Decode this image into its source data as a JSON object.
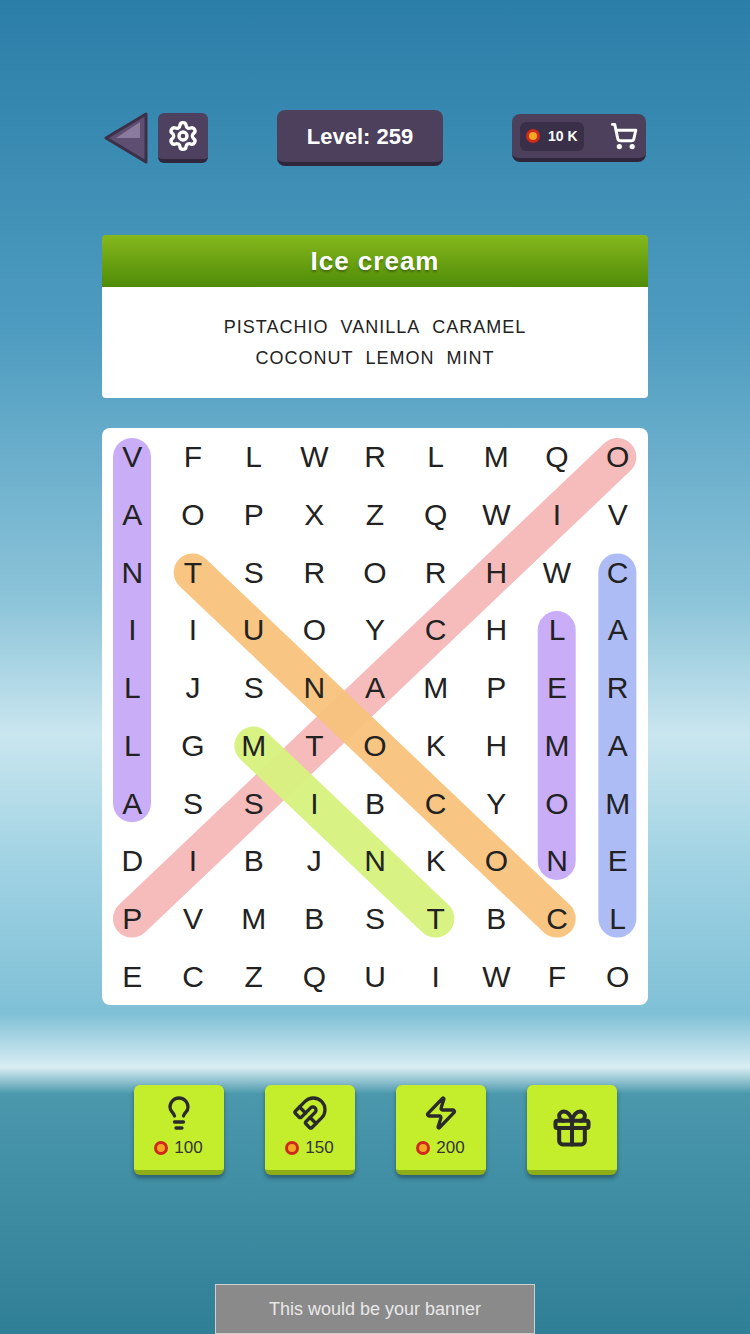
{
  "top_bar": {
    "level": "Level: 259",
    "coins": "10 K"
  },
  "category": {
    "title": "Ice cream",
    "words": [
      "PISTACHIO",
      "VANILLA",
      "CARAMEL",
      "COCONUT",
      "LEMON",
      "MINT"
    ]
  },
  "grid": {
    "rows": [
      [
        "V",
        "F",
        "L",
        "W",
        "R",
        "L",
        "M",
        "Q",
        "O"
      ],
      [
        "A",
        "O",
        "P",
        "X",
        "Z",
        "Q",
        "W",
        "I",
        "V"
      ],
      [
        "N",
        "T",
        "S",
        "R",
        "O",
        "R",
        "H",
        "W",
        "C"
      ],
      [
        "I",
        "I",
        "U",
        "O",
        "Y",
        "C",
        "H",
        "L",
        "A"
      ],
      [
        "L",
        "J",
        "S",
        "N",
        "A",
        "M",
        "P",
        "E",
        "R"
      ],
      [
        "L",
        "G",
        "M",
        "T",
        "O",
        "K",
        "H",
        "M",
        "A"
      ],
      [
        "A",
        "S",
        "S",
        "I",
        "B",
        "C",
        "Y",
        "O",
        "M"
      ],
      [
        "D",
        "I",
        "B",
        "J",
        "N",
        "K",
        "O",
        "N",
        "E"
      ],
      [
        "P",
        "V",
        "M",
        "B",
        "S",
        "T",
        "B",
        "C",
        "L"
      ],
      [
        "E",
        "C",
        "Z",
        "Q",
        "U",
        "I",
        "W",
        "F",
        "O"
      ]
    ]
  },
  "found": [
    {
      "word": "VANILLA",
      "color": "#c8a9f7",
      "from": [
        0,
        0
      ],
      "to": [
        6,
        0
      ]
    },
    {
      "word": "PISTACHIO",
      "color": "#f6b8b8",
      "from": [
        8,
        0
      ],
      "to": [
        0,
        8
      ]
    },
    {
      "word": "COCONUT",
      "color": "#f8c27c",
      "from": [
        8,
        7
      ],
      "to": [
        2,
        1
      ]
    },
    {
      "word": "MINT",
      "color": "#d8f27e",
      "from": [
        5,
        2
      ],
      "to": [
        8,
        5
      ]
    },
    {
      "word": "LEMON",
      "color": "#c8a9f7",
      "from": [
        3,
        7
      ],
      "to": [
        7,
        7
      ]
    },
    {
      "word": "CARAMEL",
      "color": "#aab9f6",
      "from": [
        2,
        8
      ],
      "to": [
        8,
        8
      ]
    }
  ],
  "boosters": [
    {
      "kind": "hint",
      "cost": "100"
    },
    {
      "kind": "magnet",
      "cost": "150"
    },
    {
      "kind": "bolt",
      "cost": "200"
    },
    {
      "kind": "video"
    }
  ],
  "banner": {
    "text": "This would be your banner"
  }
}
